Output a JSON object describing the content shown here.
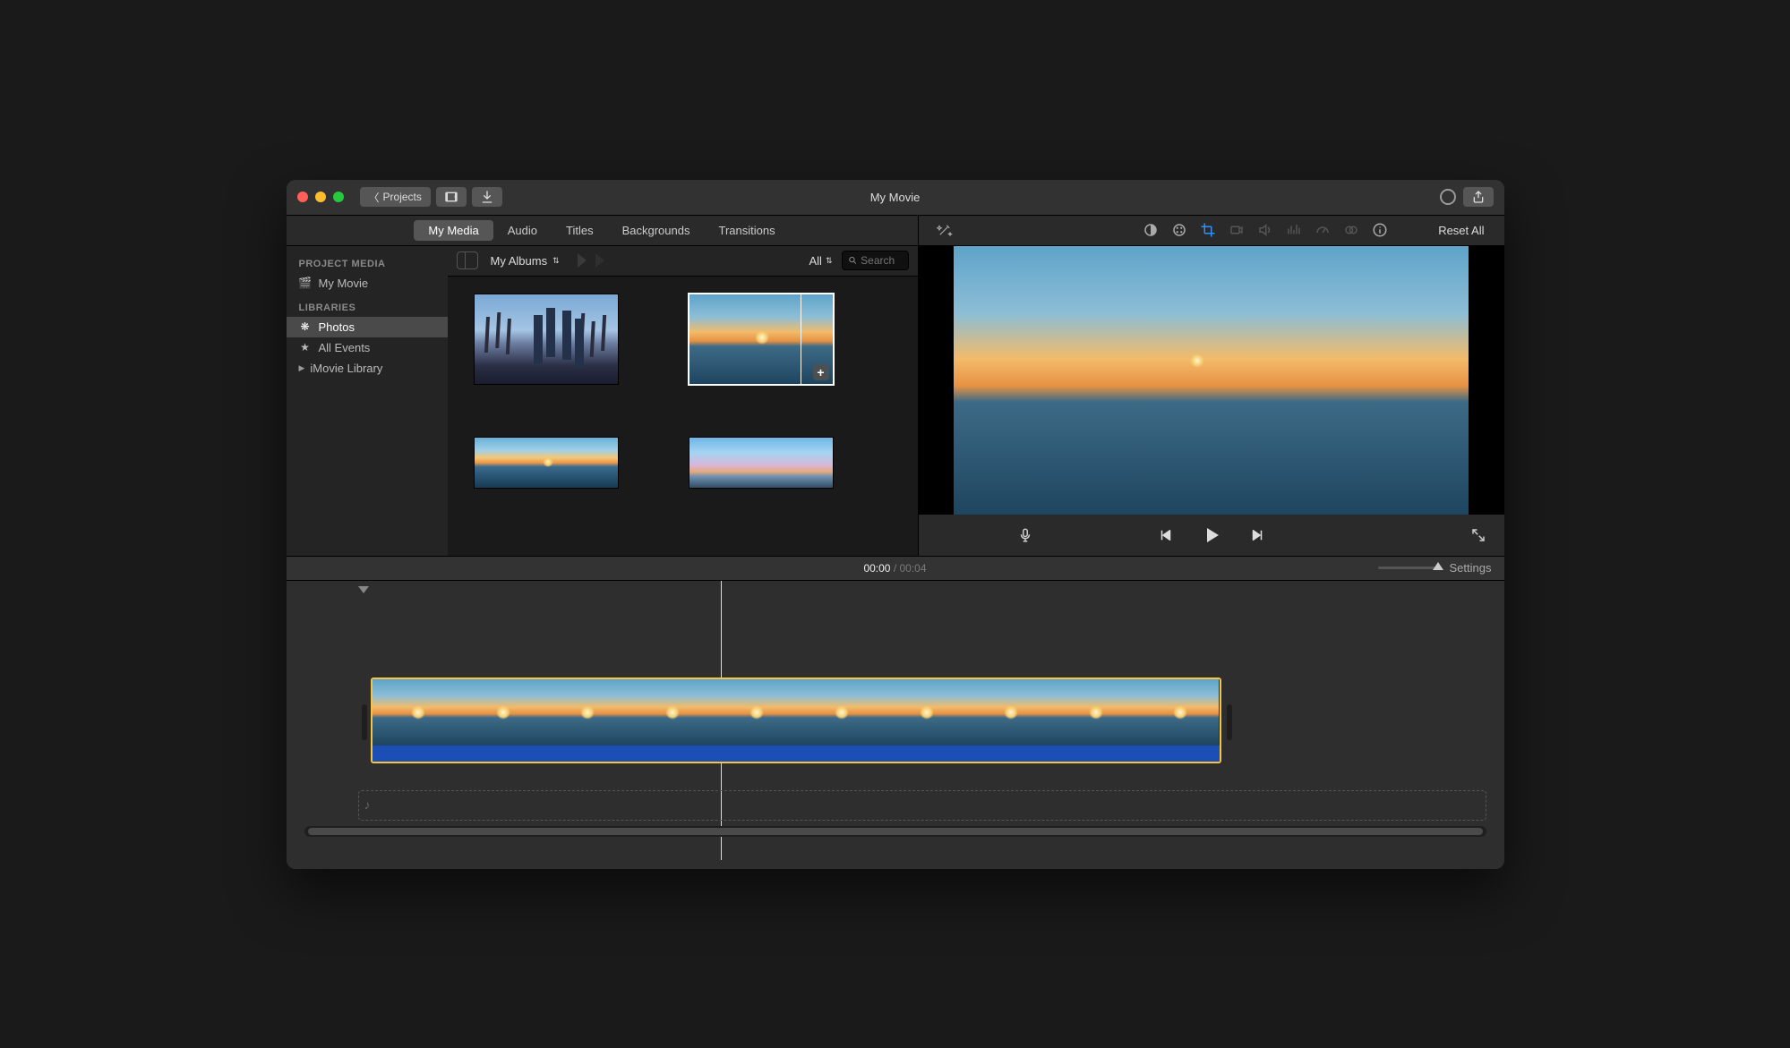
{
  "window": {
    "title": "My Movie"
  },
  "titlebar": {
    "back_label": "Projects"
  },
  "tabs": {
    "items": [
      "My Media",
      "Audio",
      "Titles",
      "Backgrounds",
      "Transitions"
    ],
    "active_index": 0
  },
  "sidebar": {
    "section1_header": "PROJECT MEDIA",
    "project_name": "My Movie",
    "section2_header": "LIBRARIES",
    "items": {
      "photos": "Photos",
      "all_events": "All Events",
      "imovie_library": "iMovie Library"
    },
    "active": "photos"
  },
  "browser": {
    "breadcrumb": "My Albums",
    "filter_label": "All",
    "search_placeholder": "Search"
  },
  "viewer": {
    "reset_label": "Reset All"
  },
  "timecode": {
    "current": "00:00",
    "separator": " / ",
    "duration": "00:04"
  },
  "timeline": {
    "settings_label": "Settings"
  }
}
